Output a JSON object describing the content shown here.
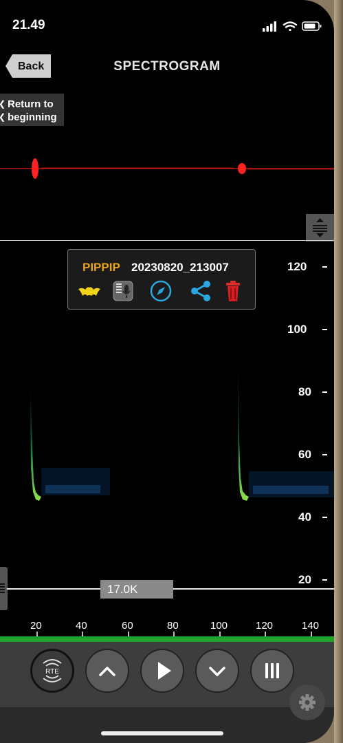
{
  "status_bar": {
    "time": "21.49"
  },
  "header": {
    "title": "SPECTROGRAM",
    "back_label": "Back"
  },
  "return_button": {
    "line1": "Return to",
    "line2": "beginning"
  },
  "recording": {
    "species": "PIPPIP",
    "filename": "20230820_213007"
  },
  "icons": [
    "bat-icon",
    "recorder-icon",
    "compass-icon",
    "share-icon",
    "trash-icon"
  ],
  "y_axis": {
    "ticks": [
      "120",
      "100",
      "80",
      "60",
      "40",
      "20"
    ]
  },
  "x_axis": {
    "ticks": [
      "20",
      "40",
      "60",
      "80",
      "100",
      "120",
      "140"
    ]
  },
  "filter": {
    "value": "17.0K"
  },
  "controls": {
    "rte_label": "RTE"
  },
  "colors": {
    "waveform": "#ff2020",
    "species": "#e8a21f",
    "accent_green": "#1fa32b",
    "icon_blue": "#29a8e0"
  }
}
